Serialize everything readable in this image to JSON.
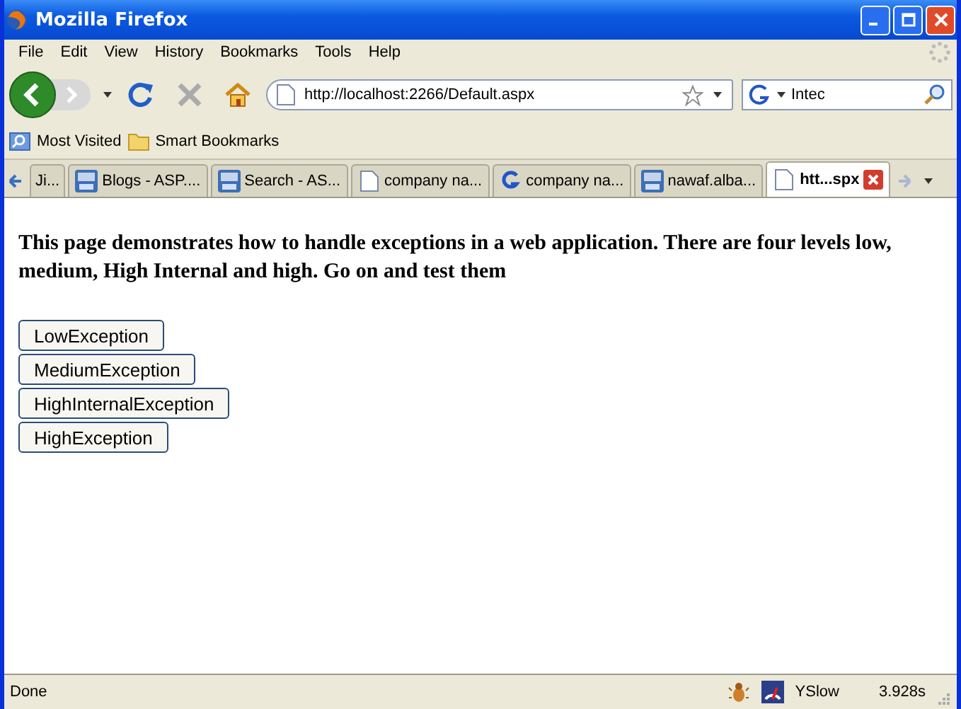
{
  "window": {
    "title": "Mozilla Firefox"
  },
  "menu": [
    "File",
    "Edit",
    "View",
    "History",
    "Bookmarks",
    "Tools",
    "Help"
  ],
  "address": {
    "value": "http://localhost:2266/Default.aspx"
  },
  "search": {
    "value": "Intec"
  },
  "bookmarks": [
    {
      "label": "Most Visited",
      "kind": "smart"
    },
    {
      "label": "Smart Bookmarks",
      "kind": "folder"
    }
  ],
  "tabs": [
    {
      "label": "Ji...",
      "kind": "none",
      "selected": false
    },
    {
      "label": "Blogs - ASP....",
      "kind": "asp",
      "selected": false
    },
    {
      "label": "Search - AS...",
      "kind": "asp",
      "selected": false
    },
    {
      "label": "company na...",
      "kind": "page",
      "selected": false
    },
    {
      "label": "company na...",
      "kind": "google",
      "selected": false
    },
    {
      "label": "nawaf.alba...",
      "kind": "asp",
      "selected": false
    },
    {
      "label": "htt...spx",
      "kind": "page",
      "selected": true
    }
  ],
  "page": {
    "intro": "This page demonstrates how to handle exceptions in a web application. There are four levels low, medium, High Internal and high. Go on and test them",
    "buttons": [
      "LowException",
      "MediumException",
      "HighInternalException",
      "HighException"
    ]
  },
  "status_bar": {
    "text": "Done",
    "yslow": "YSlow",
    "time": "3.928s"
  }
}
